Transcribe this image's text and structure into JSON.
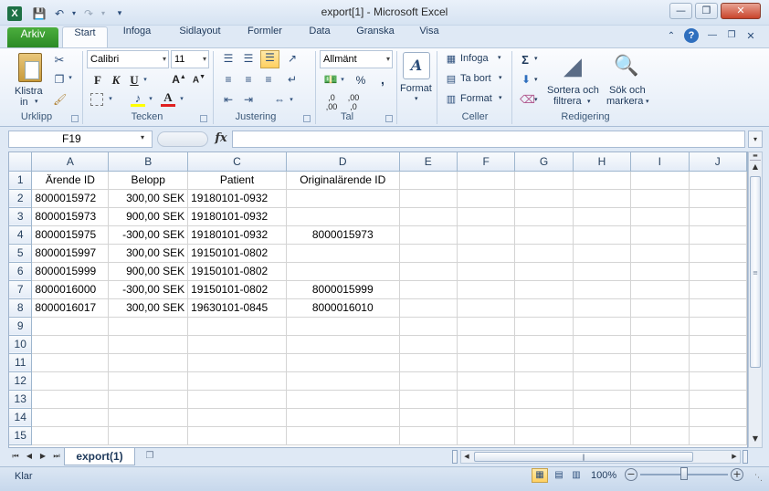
{
  "window": {
    "title": "export[1]  -  Microsoft Excel",
    "app_icon": "X"
  },
  "qat": {
    "save_icon": "save-icon",
    "undo_icon": "undo-icon",
    "redo_icon": "redo-icon"
  },
  "tabs": [
    "Start",
    "Infoga",
    "Sidlayout",
    "Formler",
    "Data",
    "Granska",
    "Visa"
  ],
  "file_tab": "Arkiv",
  "ribbon": {
    "clipboard": {
      "paste": "Klistra",
      "paste2": "in",
      "label": "Urklipp"
    },
    "font": {
      "name": "Calibri",
      "size": "11",
      "label": "Tecken"
    },
    "alignment": {
      "label": "Justering"
    },
    "number": {
      "format": "Allmänt",
      "percent": "%",
      "comma": ",",
      "label": "Tal"
    },
    "styles": {
      "label": "Format"
    },
    "cells": {
      "insert": "Infoga",
      "delete": "Ta bort",
      "format": "Format",
      "label": "Celler"
    },
    "editing": {
      "sort1": "Sortera och",
      "sort2": "filtrera",
      "find1": "Sök och",
      "find2": "markera",
      "label": "Redigering",
      "sum": "Σ"
    }
  },
  "formula": {
    "namebox": "F19",
    "fx": "fx",
    "value": ""
  },
  "grid": {
    "columns": [
      "A",
      "B",
      "C",
      "D",
      "E",
      "F",
      "G",
      "H",
      "I",
      "J"
    ],
    "rows": [
      [
        "Ärende ID",
        "Belopp",
        "Patient",
        "Originalärende ID",
        "",
        "",
        "",
        "",
        "",
        ""
      ],
      [
        "8000015972",
        "300,00 SEK",
        "19180101-0932",
        "",
        "",
        "",
        "",
        "",
        "",
        ""
      ],
      [
        "8000015973",
        "900,00 SEK",
        "19180101-0932",
        "",
        "",
        "",
        "",
        "",
        "",
        ""
      ],
      [
        "8000015975",
        "-300,00 SEK",
        "19180101-0932",
        "8000015973",
        "",
        "",
        "",
        "",
        "",
        ""
      ],
      [
        "8000015997",
        "300,00 SEK",
        "19150101-0802",
        "",
        "",
        "",
        "",
        "",
        "",
        ""
      ],
      [
        "8000015999",
        "900,00 SEK",
        "19150101-0802",
        "",
        "",
        "",
        "",
        "",
        "",
        ""
      ],
      [
        "8000016000",
        "-300,00 SEK",
        "19150101-0802",
        "8000015999",
        "",
        "",
        "",
        "",
        "",
        ""
      ],
      [
        "8000016017",
        "300,00 SEK",
        "19630101-0845",
        "8000016010",
        "",
        "",
        "",
        "",
        "",
        ""
      ],
      [
        "",
        "",
        "",
        "",
        "",
        "",
        "",
        "",
        "",
        ""
      ],
      [
        "",
        "",
        "",
        "",
        "",
        "",
        "",
        "",
        "",
        ""
      ],
      [
        "",
        "",
        "",
        "",
        "",
        "",
        "",
        "",
        "",
        ""
      ],
      [
        "",
        "",
        "",
        "",
        "",
        "",
        "",
        "",
        "",
        ""
      ],
      [
        "",
        "",
        "",
        "",
        "",
        "",
        "",
        "",
        "",
        ""
      ],
      [
        "",
        "",
        "",
        "",
        "",
        "",
        "",
        "",
        "",
        ""
      ],
      [
        "",
        "",
        "",
        "",
        "",
        "",
        "",
        "",
        "",
        ""
      ]
    ],
    "row_numbers": [
      "1",
      "2",
      "3",
      "4",
      "5",
      "6",
      "7",
      "8",
      "9",
      "10",
      "11",
      "12",
      "13",
      "14",
      "15"
    ]
  },
  "sheets": {
    "active": "export(1)"
  },
  "status": {
    "ready": "Klar",
    "zoom": "100%"
  }
}
